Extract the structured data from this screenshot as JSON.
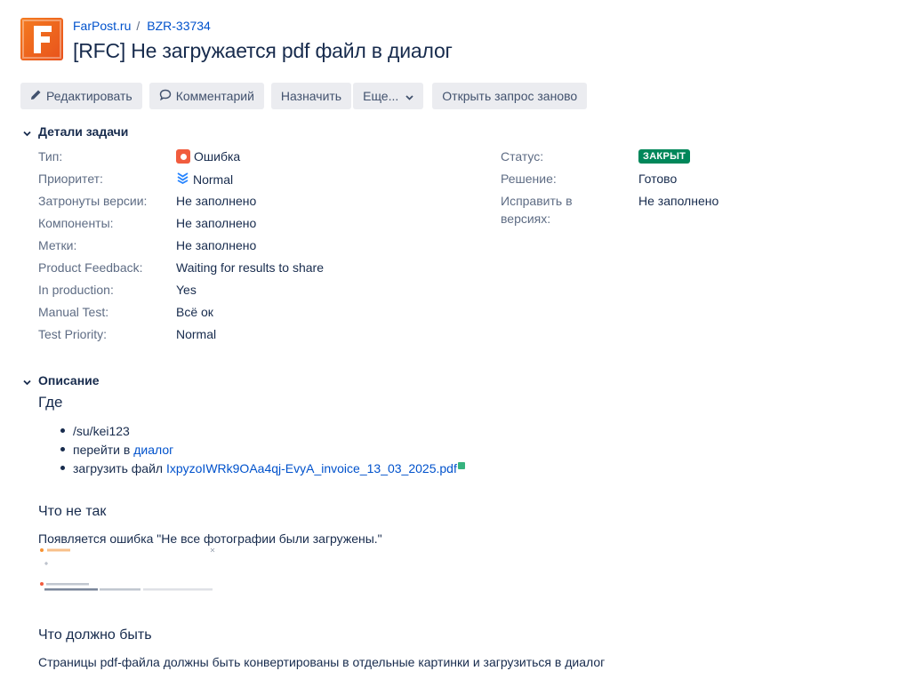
{
  "breadcrumb": {
    "project": "FarPost.ru",
    "separator": "/",
    "issue_key": "BZR-33734"
  },
  "issue": {
    "title": "[RFC] Не загружается pdf файл в диалог"
  },
  "toolbar": {
    "edit": "Редактировать",
    "comment": "Комментарий",
    "assign": "Назначить",
    "more": "Еще...",
    "reopen": "Открыть запрос заново"
  },
  "details": {
    "heading": "Детали задачи",
    "left": [
      {
        "label": "Тип:",
        "value": "Ошибка",
        "icon": "bug-type-icon"
      },
      {
        "label": "Приоритет:",
        "value": "Normal",
        "icon": "priority-normal-icon"
      },
      {
        "label": "Затронуты версии:",
        "value": "Не заполнено"
      },
      {
        "label": "Компоненты:",
        "value": "Не заполнено"
      },
      {
        "label": "Метки:",
        "value": "Не заполнено"
      },
      {
        "label": "Product Feedback:",
        "value": "Waiting for results to share"
      },
      {
        "label": "In production:",
        "value": "Yes"
      },
      {
        "label": "Manual Test:",
        "value": "Всё ок"
      },
      {
        "label": "Test Priority:",
        "value": "Normal"
      }
    ],
    "right": {
      "status_label": "Статус:",
      "status_value": "ЗАКРЫТ",
      "resolution_label": "Решение:",
      "resolution_value": "Готово",
      "fix_label_line1": "Исправить в",
      "fix_label_line2": "версиях:",
      "fix_value": "Не заполнено"
    }
  },
  "description": {
    "heading": "Описание",
    "where_heading": "Где",
    "items": {
      "path": "/su/kei123",
      "go_prefix": "перейти в ",
      "go_link": "диалог",
      "upload_prefix": "загрузить файл ",
      "upload_link": "IxpyzoIWRk9OAa4qj-EvyA_invoice_13_03_2025.pdf"
    },
    "wrong_heading": "Что не так",
    "wrong_text": "Появляется ошибка \"Не все фотографии были загружены.\"",
    "should_heading": "Что должно быть",
    "should_text": "Страницы pdf-файла должны быть конвертированы в отдельные картинки и загрузиться в диалог"
  },
  "colors": {
    "link": "#0052cc",
    "status_done": "#00875a",
    "bug": "#f15c3e",
    "logo": "#f47b20"
  }
}
